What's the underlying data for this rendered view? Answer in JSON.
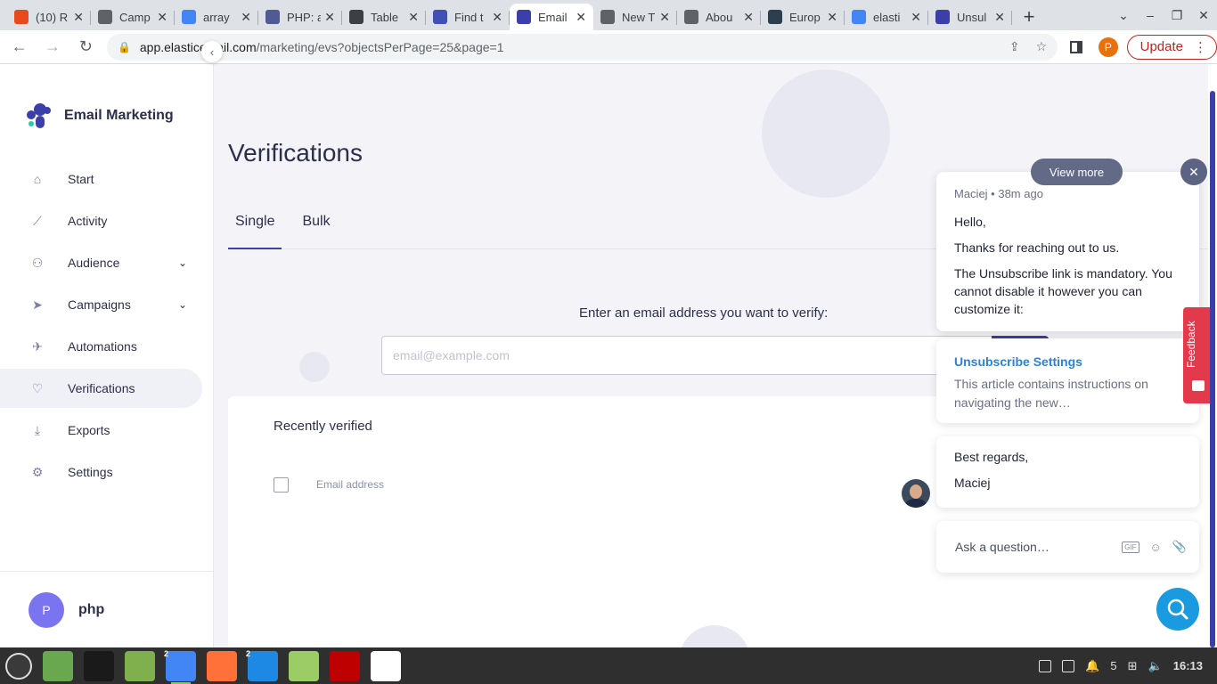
{
  "browser": {
    "tabs": [
      {
        "title": "(10) R",
        "color": "#e8491d",
        "active": false
      },
      {
        "title": "Camp",
        "color": "#5f6368",
        "active": false
      },
      {
        "title": "array",
        "color": "#4285f4",
        "active": false
      },
      {
        "title": "PHP: a",
        "color": "#4f5b93",
        "active": false
      },
      {
        "title": "Table",
        "color": "#3c4043",
        "active": false
      },
      {
        "title": "Find t",
        "color": "#3f51b5",
        "active": false
      },
      {
        "title": "Email",
        "color": "#3a40a8",
        "active": true
      },
      {
        "title": "New T",
        "color": "#5f6368",
        "active": false
      },
      {
        "title": "Abou",
        "color": "#5f6368",
        "active": false
      },
      {
        "title": "Europ",
        "color": "#2c3e50",
        "active": false
      },
      {
        "title": "elasti",
        "color": "#4285f4",
        "active": false
      },
      {
        "title": "Unsul",
        "color": "#3a40a8",
        "active": false
      }
    ],
    "url_host": "app.elasticemail.com",
    "url_path": "/marketing/evs?objectsPerPage=25&page=1",
    "profile_initial": "P",
    "update_label": "Update"
  },
  "sidebar": {
    "brand": "Email Marketing",
    "items": [
      {
        "label": "Start",
        "icon": "home-icon"
      },
      {
        "label": "Activity",
        "icon": "chart-line-icon"
      },
      {
        "label": "Audience",
        "icon": "users-icon",
        "expandable": true
      },
      {
        "label": "Campaigns",
        "icon": "send-icon",
        "expandable": true
      },
      {
        "label": "Automations",
        "icon": "rocket-icon"
      },
      {
        "label": "Verifications",
        "icon": "heart-check-icon",
        "active": true
      },
      {
        "label": "Exports",
        "icon": "download-icon"
      },
      {
        "label": "Settings",
        "icon": "gear-icon"
      }
    ],
    "user_initial": "P",
    "user_name": "php"
  },
  "main": {
    "title": "Verifications",
    "tabs": [
      "Single",
      "Bulk"
    ],
    "active_tab": "Single",
    "verify_prompt": "Enter an email address you want to verify:",
    "email_placeholder": "email@example.com",
    "recent_title": "Recently verified",
    "column_email": "Email address"
  },
  "chat": {
    "view_more": "View more",
    "close": "✕",
    "meta": "Maciej • 38m ago",
    "greeting": "Hello,",
    "line1": "Thanks for reaching out to us.",
    "line2": "The Unsubscribe link is mandatory. You cannot disable it however you can customize it:",
    "article_title": "Unsubscribe Settings",
    "article_desc": "This article contains instructions on navigating the new…",
    "regards": "Best regards,",
    "signature": "Maciej",
    "input_placeholder": "Ask a question…",
    "gif_label": "GIF",
    "feedback_label": "Feedback"
  },
  "taskbar": {
    "apps": [
      {
        "name": "menu",
        "color": "#3a3a3a"
      },
      {
        "name": "files",
        "color": "#6aa84f"
      },
      {
        "name": "terminal",
        "color": "#1a1a1a"
      },
      {
        "name": "folder",
        "color": "#7fb04d"
      },
      {
        "name": "chrome",
        "color": "#4285f4",
        "running": true,
        "badge": "2"
      },
      {
        "name": "firefox",
        "color": "#ff7139"
      },
      {
        "name": "vscode",
        "color": "#1e88e5",
        "badge": "2"
      },
      {
        "name": "image-viewer",
        "color": "#9ccc65"
      },
      {
        "name": "filezilla",
        "color": "#bf0000"
      },
      {
        "name": "proton-vpn",
        "color": "#ffffff"
      }
    ],
    "workspace": "5",
    "clock": "16:13"
  }
}
